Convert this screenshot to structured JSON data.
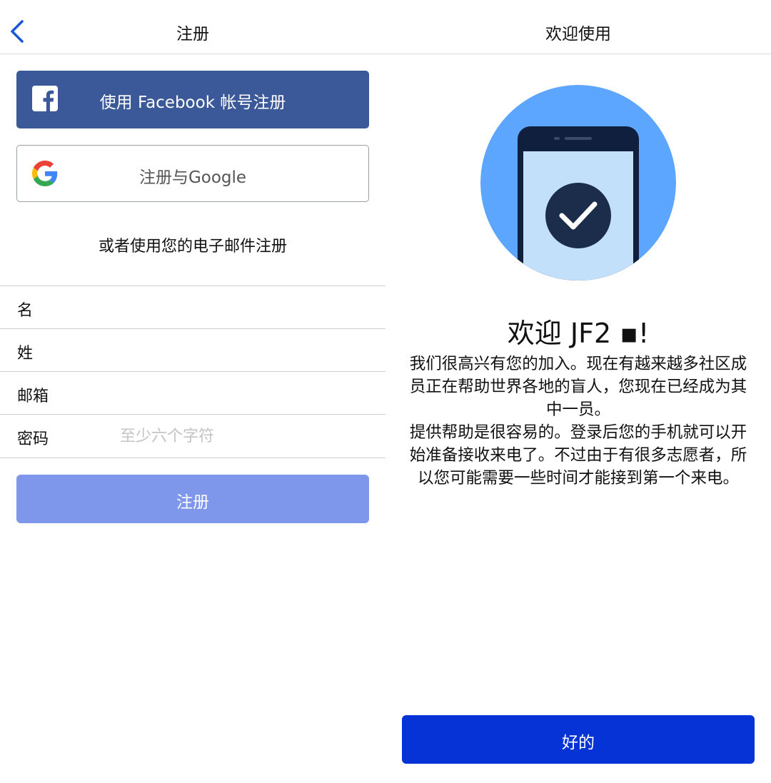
{
  "register_screen": {
    "nav_title": "注册",
    "facebook_button_label": "使用 Facebook 帐号注册",
    "google_button_label": "注册与Google",
    "or_email_text": "或者使用您的电子邮件注册",
    "fields": {
      "first_name_label": "名",
      "last_name_label": "姓",
      "email_label": "邮箱",
      "password_label": "密码",
      "password_placeholder": "至少六个字符"
    },
    "submit_button_label": "注册"
  },
  "welcome_screen": {
    "nav_title": "欢迎使用",
    "heading": "欢迎 JF2 ▪!",
    "body_paragraph_1": "我们很高兴有您的加入。现在有越来越多社区成员正在帮助世界各地的盲人，您现在已经成为其中一员。",
    "body_paragraph_2": "提供帮助是很容易的。登录后您的手机就可以开始准备接收来电了。不过由于有很多志愿者，所以您可能需要一些时间才能接到第一个来电。",
    "ok_button_label": "好的"
  },
  "colors": {
    "facebook_blue": "#3b5998",
    "register_button_disabled": "#7f97eb",
    "ok_button": "#0533d6",
    "back_chevron": "#1a55d9",
    "hero_circle": "#5ca6ff",
    "phone_body": "#0f1f3d",
    "phone_screen": "#c3e0fb",
    "check_badge": "#1c2d4c"
  },
  "icons": {
    "back": "chevron-left-icon",
    "facebook": "facebook-logo-icon",
    "google": "google-logo-icon",
    "hero": "phone-check-illustration"
  }
}
